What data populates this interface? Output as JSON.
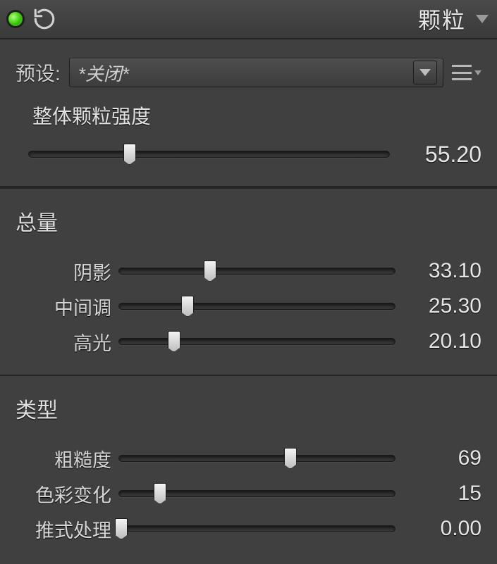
{
  "header": {
    "title": "颗粒"
  },
  "preset": {
    "label": "预设:",
    "value": "*关闭*"
  },
  "overall": {
    "label": "整体颗粒强度",
    "value": "55.20",
    "pct": 28
  },
  "sections": {
    "amount": {
      "title": "总量",
      "shadows": {
        "label": "阴影",
        "value": "33.10",
        "pct": 33
      },
      "midtones": {
        "label": "中间调",
        "value": "25.30",
        "pct": 25
      },
      "highlights": {
        "label": "高光",
        "value": "20.10",
        "pct": 20
      }
    },
    "type": {
      "title": "类型",
      "roughness": {
        "label": "粗糙度",
        "value": "69",
        "pct": 62
      },
      "colorvar": {
        "label": "色彩变化",
        "value": "15",
        "pct": 15
      },
      "pushproc": {
        "label": "推式处理",
        "value": "0.00",
        "pct": 1
      }
    }
  }
}
